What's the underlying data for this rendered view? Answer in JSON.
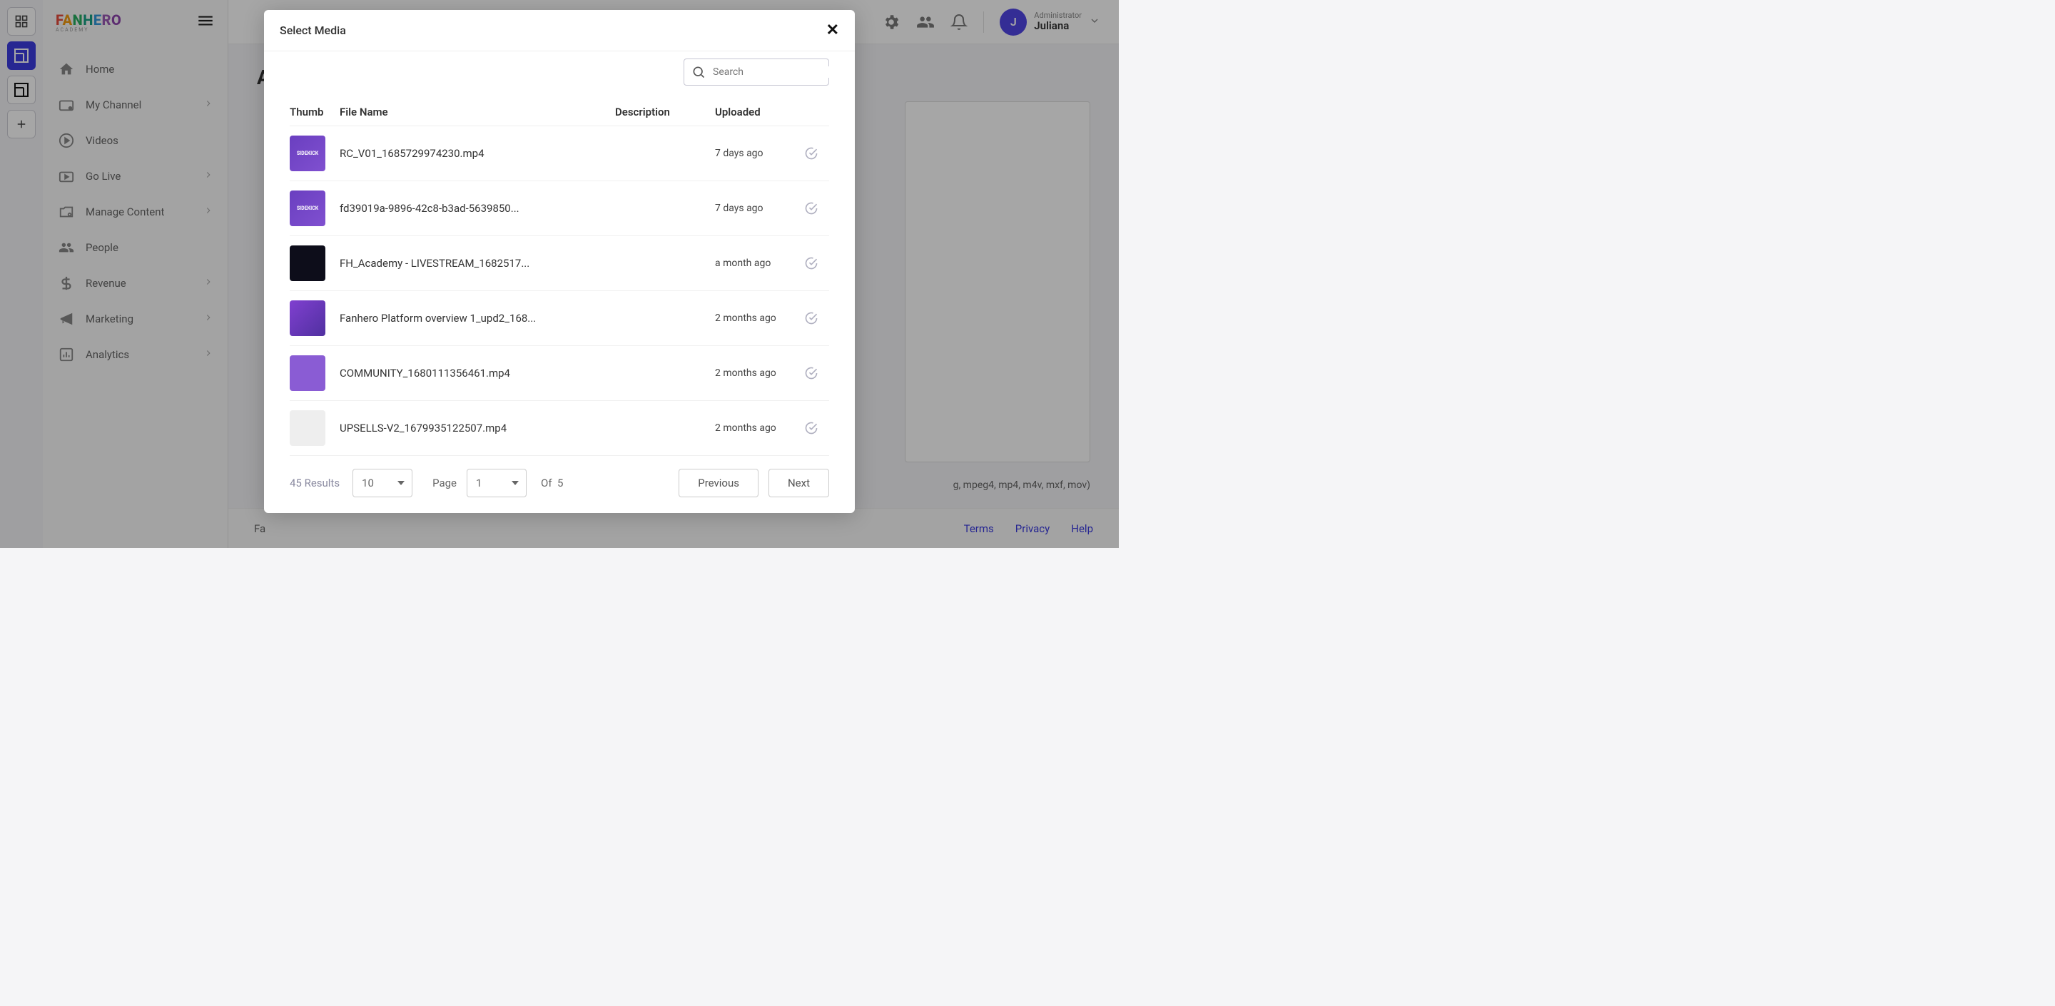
{
  "brand": {
    "name": "FANHERO",
    "sub": "ACADEMY"
  },
  "sidebar": {
    "items": [
      {
        "label": "Home",
        "icon": "home",
        "expandable": false
      },
      {
        "label": "My Channel",
        "icon": "channel",
        "expandable": true
      },
      {
        "label": "Videos",
        "icon": "videos",
        "expandable": false
      },
      {
        "label": "Go Live",
        "icon": "golive",
        "expandable": true
      },
      {
        "label": "Manage Content",
        "icon": "manage",
        "expandable": true
      },
      {
        "label": "People",
        "icon": "people",
        "expandable": false
      },
      {
        "label": "Revenue",
        "icon": "revenue",
        "expandable": true
      },
      {
        "label": "Marketing",
        "icon": "marketing",
        "expandable": true
      },
      {
        "label": "Analytics",
        "icon": "analytics",
        "expandable": true
      }
    ]
  },
  "topbar": {
    "user_role": "Administrator",
    "user_name": "Juliana",
    "avatar_initial": "J"
  },
  "main": {
    "title_fragment": "Ad",
    "hint_fragment": "g, mpeg4, mp4, m4v, mxf, mov)"
  },
  "footer": {
    "company_fragment": "Fa",
    "links": {
      "terms": "Terms",
      "privacy": "Privacy",
      "help": "Help"
    }
  },
  "modal": {
    "title": "Select Media",
    "search_placeholder": "Search",
    "columns": {
      "thumb": "Thumb",
      "filename": "File Name",
      "description": "Description",
      "uploaded": "Uploaded"
    },
    "rows": [
      {
        "thumb_text": "SIDEKICK",
        "thumb_class": "t1",
        "filename": "RC_V01_1685729974230.mp4",
        "description": "",
        "uploaded": "7 days ago"
      },
      {
        "thumb_text": "SIDEKICK",
        "thumb_class": "t2",
        "filename": "fd39019a-9896-42c8-b3ad-5639850...",
        "description": "",
        "uploaded": "7 days ago"
      },
      {
        "thumb_text": "",
        "thumb_class": "t3",
        "filename": "FH_Academy - LIVESTREAM_1682517...",
        "description": "",
        "uploaded": "a month ago"
      },
      {
        "thumb_text": "",
        "thumb_class": "t4",
        "filename": "Fanhero Platform overview 1_upd2_168...",
        "description": "",
        "uploaded": "2 months ago"
      },
      {
        "thumb_text": "",
        "thumb_class": "t5",
        "filename": "COMMUNITY_1680111356461.mp4",
        "description": "",
        "uploaded": "2 months ago"
      },
      {
        "thumb_text": "",
        "thumb_class": "t6",
        "filename": "UPSELLS-V2_1679935122507.mp4",
        "description": "",
        "uploaded": "2 months ago"
      }
    ],
    "pagination": {
      "results_label": "45 Results",
      "per_page": "10",
      "page_label": "Page",
      "current_page": "1",
      "of_label": "Of",
      "total_pages": "5",
      "previous": "Previous",
      "next": "Next"
    }
  }
}
